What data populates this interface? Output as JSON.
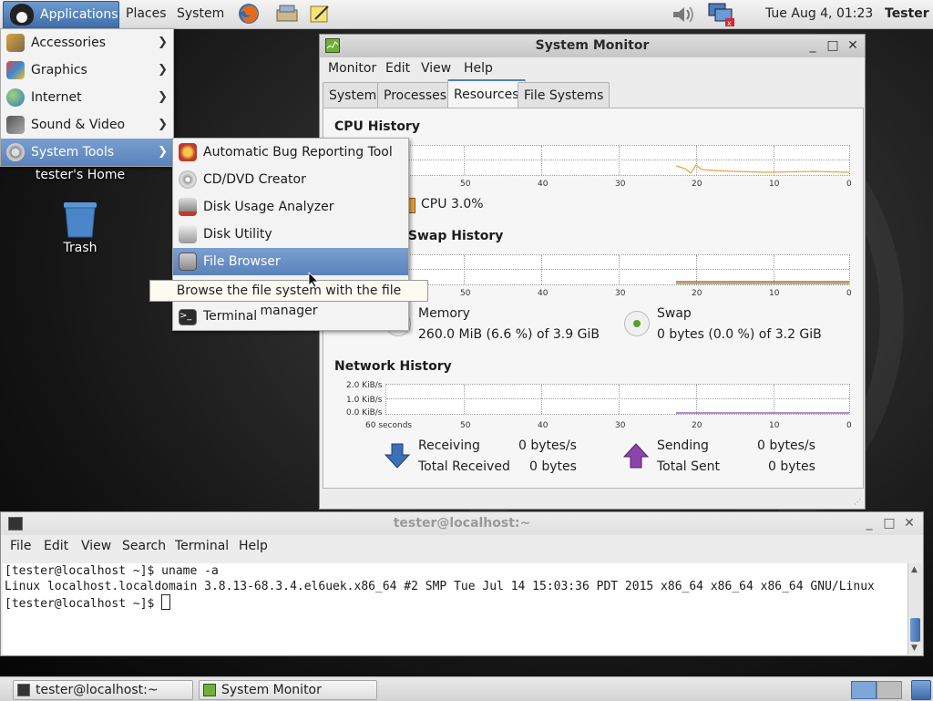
{
  "top_panel": {
    "applications_label": "Applications",
    "places_label": "Places",
    "system_label": "System",
    "clock": "Tue Aug  4, 01:23",
    "user": "Tester",
    "launchers": [
      "firefox-icon",
      "screenshot-icon",
      "notes-icon"
    ]
  },
  "app_menu": {
    "items": [
      {
        "label": "Accessories",
        "icon": "accessories-icon"
      },
      {
        "label": "Graphics",
        "icon": "graphics-icon"
      },
      {
        "label": "Internet",
        "icon": "internet-icon"
      },
      {
        "label": "Sound & Video",
        "icon": "sound-video-icon"
      },
      {
        "label": "System Tools",
        "icon": "system-tools-icon"
      }
    ],
    "submenu": [
      {
        "label": "Automatic Bug Reporting Tool"
      },
      {
        "label": "CD/DVD Creator"
      },
      {
        "label": "Disk Usage Analyzer"
      },
      {
        "label": "Disk Utility"
      },
      {
        "label": "File Browser"
      },
      {
        "label": "Terminal"
      }
    ],
    "tooltip": "Browse the file system with the file manager"
  },
  "desktop": {
    "home_label": "tester's Home",
    "trash_label": "Trash"
  },
  "system_monitor": {
    "title": "System Monitor",
    "menus": [
      "Monitor",
      "Edit",
      "View",
      "Help"
    ],
    "tabs": [
      "System",
      "Processes",
      "Resources",
      "File Systems"
    ],
    "active_tab": "Resources",
    "cpu": {
      "title": "CPU History",
      "label": "CPU",
      "value": "3.0%",
      "ticks": [
        "50",
        "40",
        "30",
        "20",
        "10",
        "0"
      ]
    },
    "memory": {
      "title_fragment": "nd Swap History",
      "ticks": [
        "50",
        "40",
        "30",
        "20",
        "10",
        "0"
      ],
      "memory_label": "Memory",
      "memory_value": "260.0 MiB (6.6 %) of 3.9 GiB",
      "swap_label": "Swap",
      "swap_value": "0 bytes (0.0 %) of 3.2 GiB"
    },
    "network": {
      "title": "Network History",
      "y_ticks": [
        "2.0 KiB/s",
        "1.0 KiB/s",
        "0.0 KiB/s"
      ],
      "x_first": "60 seconds",
      "ticks": [
        "50",
        "40",
        "30",
        "20",
        "10",
        "0"
      ],
      "receiving_label": "Receiving",
      "receiving_value": "0 bytes/s",
      "total_received_label": "Total Received",
      "total_received_value": "0 bytes",
      "sending_label": "Sending",
      "sending_value": "0 bytes/s",
      "total_sent_label": "Total Sent",
      "total_sent_value": "0 bytes"
    },
    "colors": {
      "cpu": "#e8a23a",
      "memory": "#c0392b",
      "swap": "#5aa02c",
      "receiving": "#3b6fb6",
      "sending": "#8e44ad"
    }
  },
  "terminal": {
    "title": "tester@localhost:~",
    "menus": [
      "File",
      "Edit",
      "View",
      "Search",
      "Terminal",
      "Help"
    ],
    "lines": [
      "[tester@localhost ~]$ uname -a",
      "Linux localhost.localdomain 3.8.13-68.3.4.el6uek.x86_64 #2 SMP Tue Jul 14 15:03:36 PDT 2015 x86_64 x86_64 x86_64 GNU/Linux",
      "[tester@localhost ~]$ "
    ]
  },
  "taskbar": {
    "tasks": [
      {
        "label": "tester@localhost:~"
      },
      {
        "label": "System Monitor"
      }
    ]
  }
}
